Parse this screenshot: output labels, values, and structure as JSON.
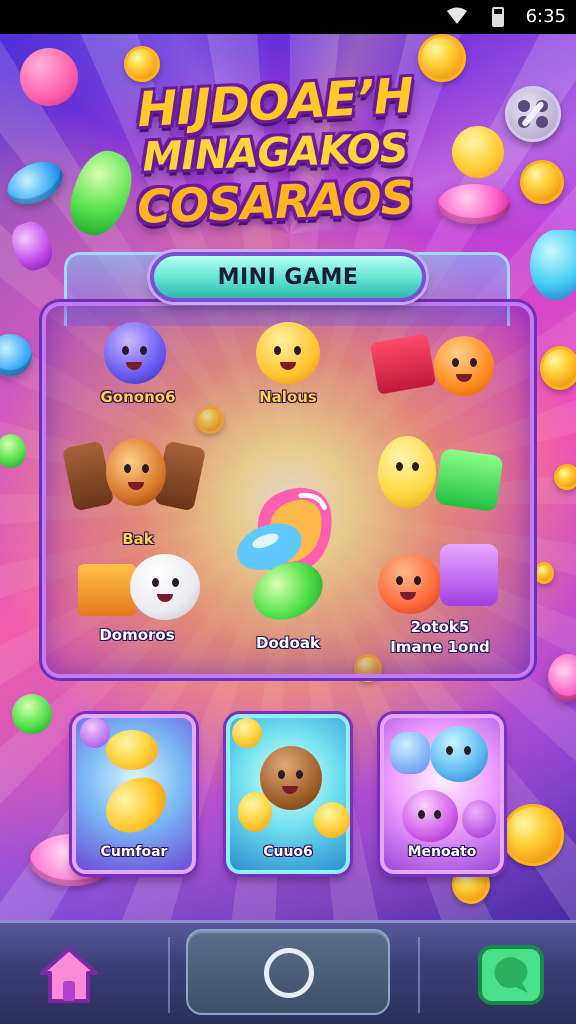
{
  "status_bar": {
    "time": "6:35"
  },
  "title": {
    "line1": "HIJDOAEʼH",
    "line2": "MINAGAKOS",
    "line3": "COSARAOS"
  },
  "panel": {
    "header": "MINI GAME",
    "items": [
      {
        "label": "Gonono6"
      },
      {
        "label": "Nalous"
      },
      {
        "label": "Bak"
      },
      {
        "label": "Domoros"
      },
      {
        "label": "Dodoak"
      },
      {
        "label": "2otok5",
        "sublabel": "Imane 1ond"
      }
    ]
  },
  "cards": [
    {
      "label": "Cumfoar"
    },
    {
      "label": "Cuuo6"
    },
    {
      "label": "Menoato"
    }
  ],
  "colors": {
    "title_gold": "#ffd53a",
    "header_teal": "#5fe3d0",
    "panel_border": "#c27bf2"
  },
  "nav": {
    "home_icon": "home-icon",
    "center_icon": "circle-icon",
    "right_icon": "chat-bubble-icon"
  }
}
